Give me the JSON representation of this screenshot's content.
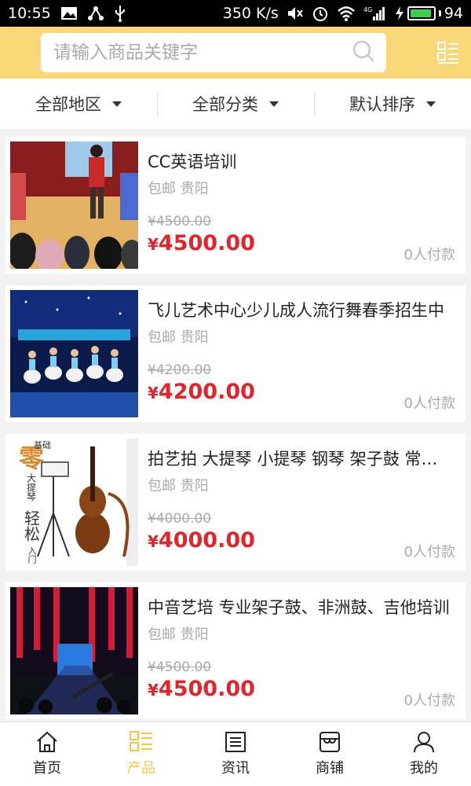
{
  "status": {
    "time": "10:55",
    "speed": "350 K/s",
    "network": "4G",
    "battery": "94"
  },
  "search": {
    "placeholder": "请输入商品关键字"
  },
  "filters": [
    "全部地区",
    "全部分类",
    "默认排序"
  ],
  "products": [
    {
      "title": "CC英语培训",
      "location": "包邮 贵阳",
      "old_price": "¥4500.00",
      "price_symbol": "¥",
      "price": "4500.00",
      "paid": "0人付款"
    },
    {
      "title": "飞儿艺术中心少儿成人流行舞春季招生中",
      "location": "包邮 贵阳",
      "old_price": "¥4200.00",
      "price_symbol": "¥",
      "price": "4200.00",
      "paid": "0人付款"
    },
    {
      "title": "拍艺拍 大提琴 小提琴 钢琴 架子鼓 常年招生",
      "location": "包邮 贵阳",
      "old_price": "¥4000.00",
      "price_symbol": "¥",
      "price": "4000.00",
      "paid": "0人付款",
      "image_text": {
        "top": "零",
        "top_small": "基础",
        "side": "大提琴",
        "big": "轻松",
        "bottom": "入门"
      }
    },
    {
      "title": "中音艺培 专业架子鼓、非洲鼓、吉他培训",
      "location": "包邮 贵阳",
      "old_price": "¥4500.00",
      "price_symbol": "¥",
      "price": "4500.00",
      "paid": "0人付款"
    }
  ],
  "tabs": [
    {
      "label": "首页",
      "icon": "home-icon"
    },
    {
      "label": "产品",
      "icon": "product-grid-icon"
    },
    {
      "label": "资讯",
      "icon": "news-icon"
    },
    {
      "label": "商铺",
      "icon": "store-icon"
    },
    {
      "label": "我的",
      "icon": "user-icon"
    }
  ],
  "colors": {
    "header": "#fad87a",
    "price": "#e0262d",
    "active_tab": "#f2c84d"
  }
}
